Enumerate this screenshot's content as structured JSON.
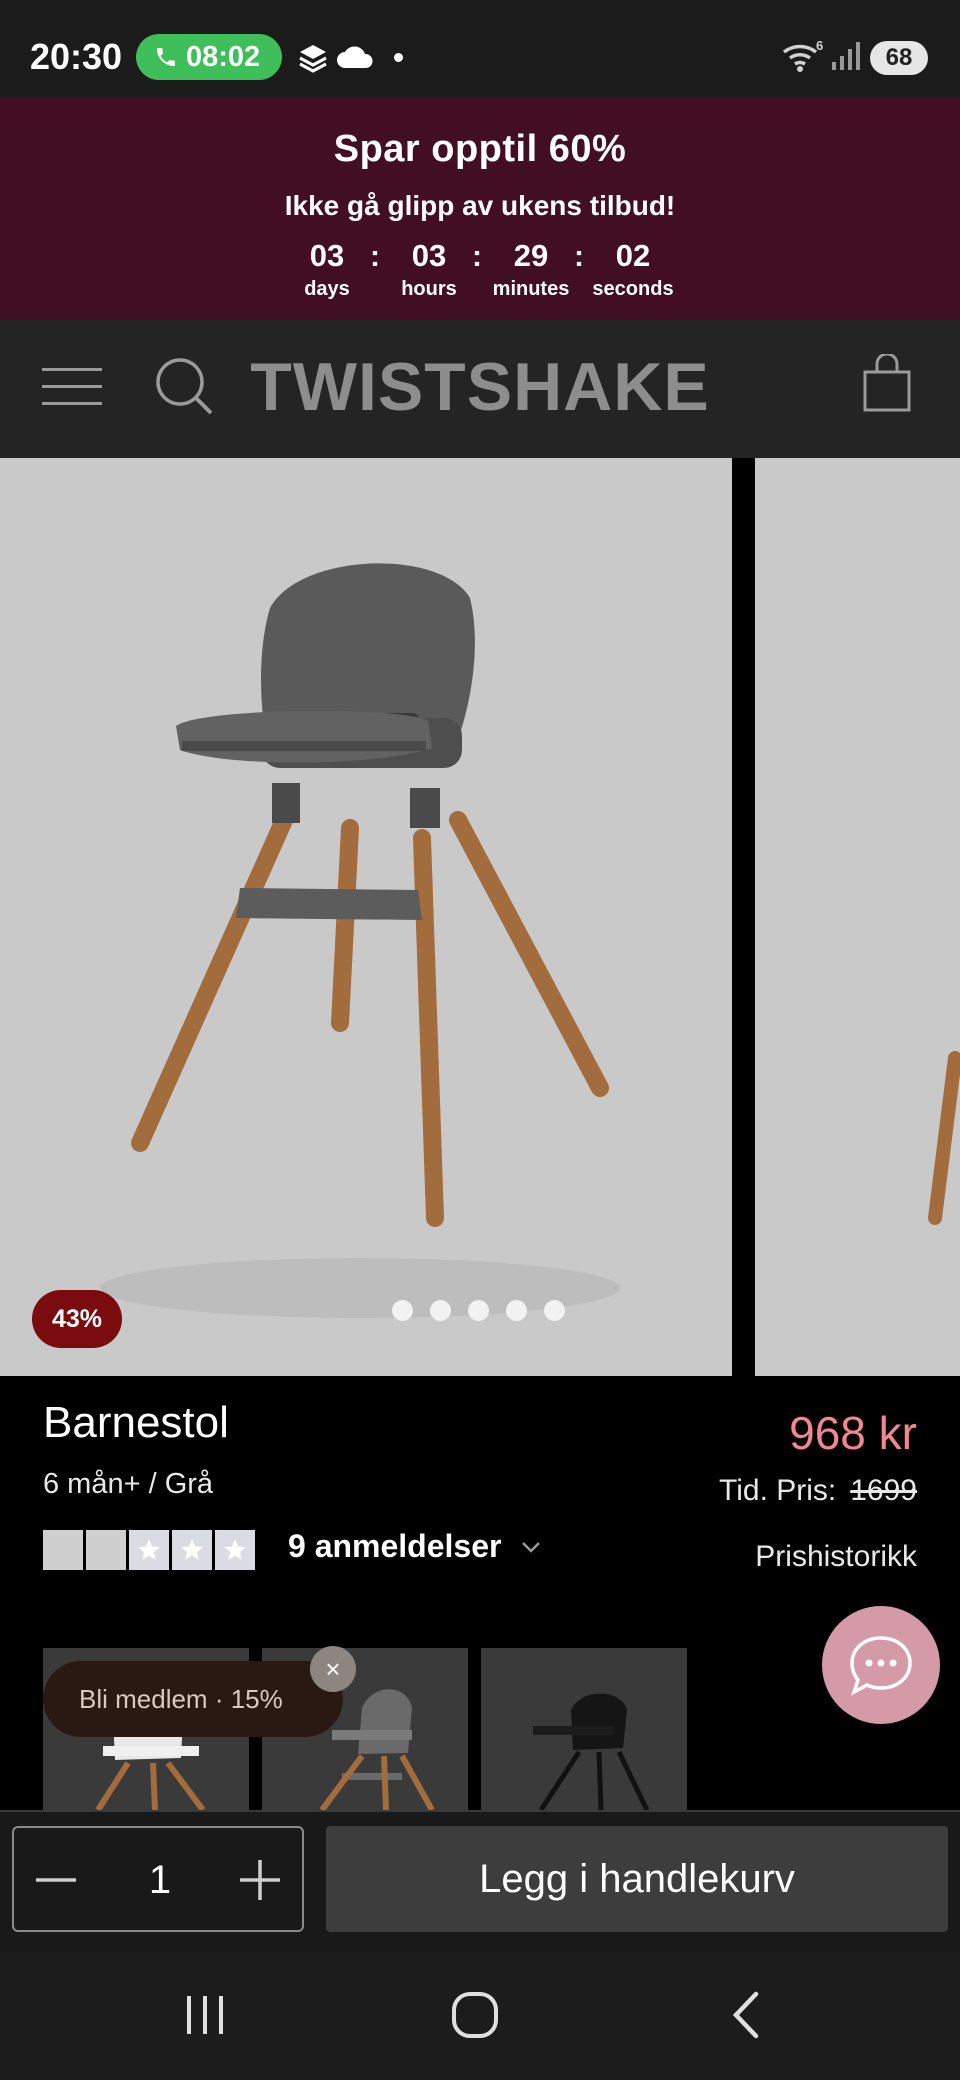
{
  "status_bar": {
    "time": "20:30",
    "call_time": "08:02",
    "wifi_label": "6",
    "battery": "68"
  },
  "promo": {
    "title": "Spar opptil 60%",
    "subtitle": "Ikke gå glipp av ukens tilbud!",
    "countdown": [
      {
        "value": "03",
        "label": "days"
      },
      {
        "value": "03",
        "label": "hours"
      },
      {
        "value": "29",
        "label": "minutes"
      },
      {
        "value": "02",
        "label": "seconds"
      }
    ]
  },
  "header": {
    "brand": "TWISTSHAKE"
  },
  "gallery": {
    "discount_badge": "43%",
    "slide_count": 5,
    "active_slide": 1
  },
  "product": {
    "title": "Barnestol",
    "variant": "6 mån+ / Grå",
    "reviews_label": "9 anmeldelser",
    "rating": 0,
    "price": "968 kr",
    "old_price_label": "Tid. Pris:",
    "old_price": "1699",
    "history_link": "Prishistorikk"
  },
  "member_popup": {
    "label": "Bli medlem · 15%",
    "close": "×"
  },
  "buy_bar": {
    "quantity": "1",
    "add_to_cart": "Legg i handlekurv"
  },
  "colors": {
    "promo_bg": "#420e21",
    "price": "#f2878f",
    "badge": "#7a0b0e",
    "call_pill": "#3fbf5a",
    "chat": "#d59aa7"
  }
}
